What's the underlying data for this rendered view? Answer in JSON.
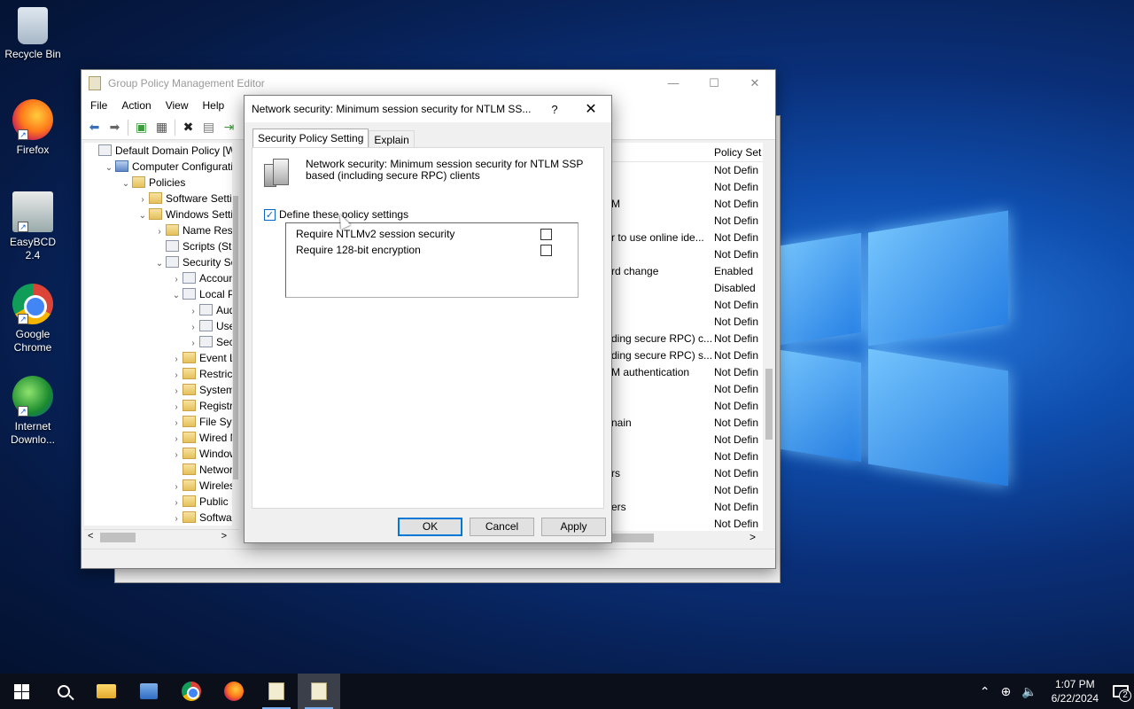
{
  "desktop": {
    "icons": [
      {
        "label": "Recycle Bin",
        "icon": "recycle-bin-icon"
      },
      {
        "label": "Firefox",
        "icon": "firefox-icon"
      },
      {
        "label": "EasyBCD 2.4",
        "icon": "easybcd-icon"
      },
      {
        "label": "Google Chrome",
        "icon": "chrome-icon"
      },
      {
        "label": "Internet Downlo...",
        "icon": "idm-icon"
      }
    ]
  },
  "mmc": {
    "title": "Group Policy Management Editor",
    "menu": [
      "File",
      "Action",
      "View",
      "Help"
    ],
    "tree": [
      {
        "label": "Default Domain Policy [WIN",
        "indent": 0,
        "arrow": ""
      },
      {
        "label": "Computer Configuration",
        "indent": 1,
        "arrow": "v"
      },
      {
        "label": "Policies",
        "indent": 2,
        "arrow": "v"
      },
      {
        "label": "Software Settings",
        "indent": 3,
        "arrow": ">"
      },
      {
        "label": "Windows Settings",
        "indent": 3,
        "arrow": "v"
      },
      {
        "label": "Name Resoluti",
        "indent": 4,
        "arrow": ">"
      },
      {
        "label": "Scripts (Startu",
        "indent": 4,
        "arrow": ""
      },
      {
        "label": "Security Settin",
        "indent": 4,
        "arrow": "v"
      },
      {
        "label": "Account P",
        "indent": 5,
        "arrow": ">"
      },
      {
        "label": "Local Polic",
        "indent": 5,
        "arrow": "v"
      },
      {
        "label": "Audit P",
        "indent": 6,
        "arrow": ">"
      },
      {
        "label": "User Ri",
        "indent": 6,
        "arrow": ">"
      },
      {
        "label": "Securit",
        "indent": 6,
        "arrow": ">"
      },
      {
        "label": "Event Log",
        "indent": 5,
        "arrow": ">"
      },
      {
        "label": "Restricted",
        "indent": 5,
        "arrow": ">"
      },
      {
        "label": "System Se",
        "indent": 5,
        "arrow": ">"
      },
      {
        "label": "Registry",
        "indent": 5,
        "arrow": ">"
      },
      {
        "label": "File System",
        "indent": 5,
        "arrow": ">"
      },
      {
        "label": "Wired Net",
        "indent": 5,
        "arrow": ">"
      },
      {
        "label": "Windows I",
        "indent": 5,
        "arrow": ">"
      },
      {
        "label": "Network L",
        "indent": 5,
        "arrow": ""
      },
      {
        "label": "Wireless N",
        "indent": 5,
        "arrow": ">"
      },
      {
        "label": "Public Key",
        "indent": 5,
        "arrow": ">"
      },
      {
        "label": "Software R",
        "indent": 5,
        "arrow": ">"
      }
    ],
    "column_header": "Policy Set",
    "rows": [
      {
        "frag": "",
        "val": "Not Defin"
      },
      {
        "frag": "",
        "val": "Not Defin"
      },
      {
        "frag": "M",
        "val": "Not Defin"
      },
      {
        "frag": "",
        "val": "Not Defin"
      },
      {
        "frag": "r to use online ide...",
        "val": "Not Defin"
      },
      {
        "frag": "",
        "val": "Not Defin"
      },
      {
        "frag": "rd change",
        "val": "Enabled"
      },
      {
        "frag": "",
        "val": "Disabled"
      },
      {
        "frag": "",
        "val": "Not Defin"
      },
      {
        "frag": "",
        "val": "Not Defin"
      },
      {
        "frag": "ding secure RPC) c...",
        "val": "Not Defin"
      },
      {
        "frag": "ding secure RPC) s...",
        "val": "Not Defin"
      },
      {
        "frag": "M authentication",
        "val": "Not Defin"
      },
      {
        "frag": "",
        "val": "Not Defin"
      },
      {
        "frag": "",
        "val": "Not Defin"
      },
      {
        "frag": "nain",
        "val": "Not Defin"
      },
      {
        "frag": "",
        "val": "Not Defin"
      },
      {
        "frag": "",
        "val": "Not Defin"
      },
      {
        "frag": "rs",
        "val": "Not Defin"
      },
      {
        "frag": "",
        "val": "Not Defin"
      },
      {
        "frag": "ers",
        "val": "Not Defin"
      },
      {
        "frag": "",
        "val": "Not Defin"
      }
    ]
  },
  "dialog": {
    "title": "Network security: Minimum session security for NTLM SS...",
    "help": "?",
    "tabs": [
      "Security Policy Setting",
      "Explain"
    ],
    "policy_text": "Network security: Minimum session security for NTLM SSP based (including secure RPC) clients",
    "define_label": "Define these policy settings",
    "define_checked": true,
    "options": [
      {
        "label": "Require NTLMv2 session security",
        "checked": false
      },
      {
        "label": "Require 128-bit encryption",
        "checked": false
      }
    ],
    "buttons": {
      "ok": "OK",
      "cancel": "Cancel",
      "apply": "Apply"
    }
  },
  "taskbar": {
    "time": "1:07 PM",
    "date": "6/22/2024",
    "notifications": "2"
  }
}
